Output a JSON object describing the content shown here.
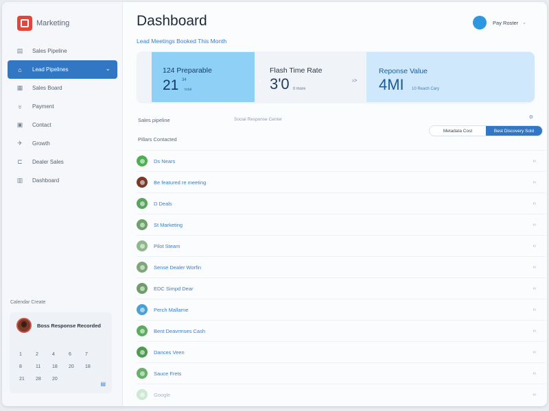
{
  "app": {
    "logo_subtext": "",
    "logo_name": "Marketing"
  },
  "sidebar": {
    "items": [
      {
        "label": "Sales Pipeline",
        "icon": "grid-icon",
        "active": false
      },
      {
        "label": "Lead Pipelines",
        "icon": "home-icon",
        "active": true
      },
      {
        "label": "Sales Board",
        "icon": "board-icon",
        "active": false
      },
      {
        "label": "Payment",
        "icon": "wallet-icon",
        "active": false
      },
      {
        "label": "Contact",
        "icon": "contact-icon",
        "active": false
      },
      {
        "label": "Growth",
        "icon": "bird-icon",
        "active": false
      },
      {
        "label": "Dealer Sales",
        "icon": "bracket-icon",
        "active": false
      },
      {
        "label": "Dashboard",
        "icon": "dashboard-icon",
        "active": false
      }
    ],
    "calendar": {
      "title": "Calendar Create",
      "user_name": "Boss Response Recorded",
      "user_sub": "",
      "days": [
        [
          "1",
          "2",
          "4",
          "6",
          "7"
        ],
        [
          "8",
          "11",
          "18",
          "20",
          "18"
        ],
        [
          "21",
          "28",
          "20",
          "",
          ""
        ]
      ]
    }
  },
  "header": {
    "title": "Dashboard",
    "subtitle": "Lead Meetings Booked This Month",
    "profile_name": "Pay Roster"
  },
  "kpis": [
    {
      "label": "124 Preparable",
      "value": "21",
      "unit": "34",
      "small": "total"
    },
    {
      "label": "Flash Time Rate",
      "value": "3'0",
      "small": "tl more"
    },
    {
      "label": "Reponse Value",
      "value": "4MI",
      "small": "10 Reach Cary"
    }
  ],
  "filters": {
    "section_label": "Sales pipeline",
    "section_hint": "Social Response Center",
    "toggle_left": "Metadata Cost",
    "toggle_right": "Best Discovery Sold",
    "list_header": "Pillars Contacted"
  },
  "list": [
    {
      "label": "Ds Nears",
      "color": "#4caf50",
      "faded": false
    },
    {
      "label": "Be featured re meeting",
      "color": "#7a3a2a",
      "faded": false
    },
    {
      "label": "D Deals",
      "color": "#5aa55e",
      "faded": false
    },
    {
      "label": "St Marketing",
      "color": "#6fa26a",
      "faded": false
    },
    {
      "label": "Pilot Steam",
      "color": "#8fb88a",
      "faded": false
    },
    {
      "label": "Sense Dealer Worfin",
      "color": "#7fa679",
      "faded": false
    },
    {
      "label": "EDC Simpd Dear",
      "color": "#6f9d69",
      "faded": false
    },
    {
      "label": "Perch Mallarne",
      "color": "#4a9fd4",
      "faded": false
    },
    {
      "label": "Bent Deavrmses Cash",
      "color": "#5aad5e",
      "faded": false
    },
    {
      "label": "Dances Veen",
      "color": "#4f9b52",
      "faded": false
    },
    {
      "label": "Sauce Frets",
      "color": "#66b068",
      "faded": false
    },
    {
      "label": "Google",
      "color": "#8ccf8f",
      "faded": true
    }
  ],
  "row_action": "‹›"
}
